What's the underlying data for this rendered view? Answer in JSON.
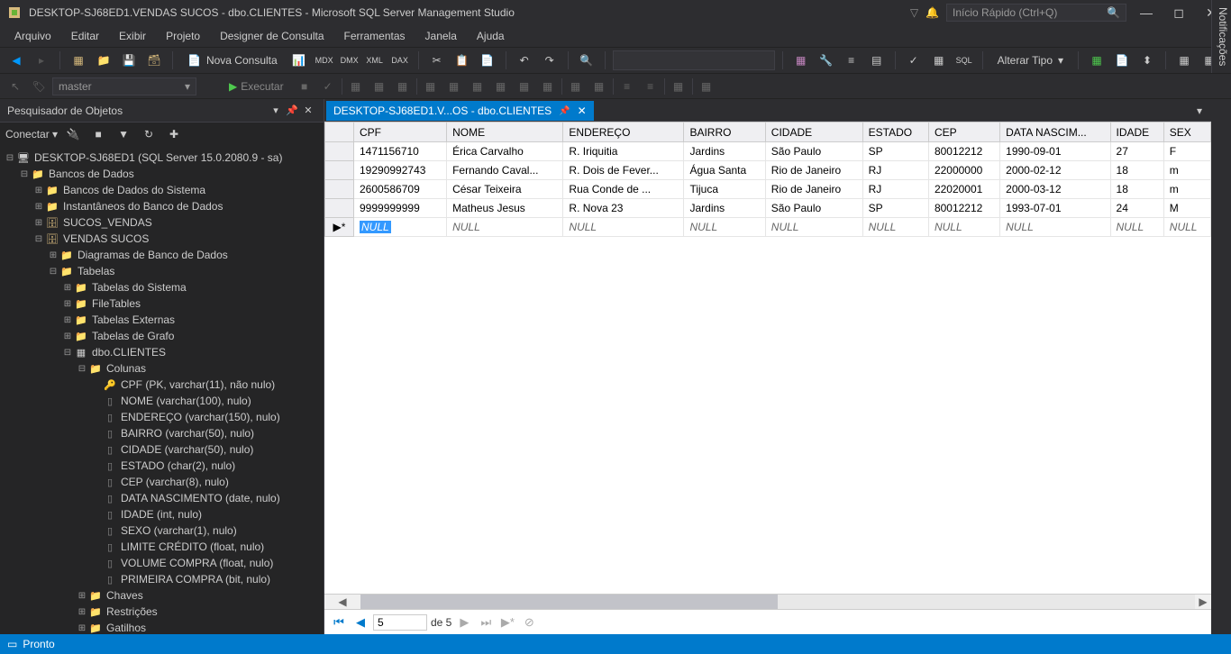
{
  "window": {
    "title": "DESKTOP-SJ68ED1.VENDAS SUCOS - dbo.CLIENTES - Microsoft SQL Server Management Studio",
    "quick_launch_placeholder": "Início Rápido (Ctrl+Q)"
  },
  "menu": [
    "Arquivo",
    "Editar",
    "Exibir",
    "Projeto",
    "Designer de Consulta",
    "Ferramentas",
    "Janela",
    "Ajuda"
  ],
  "toolbar": {
    "nova_consulta": "Nova Consulta",
    "alterar_tipo": "Alterar Tipo"
  },
  "toolbar2": {
    "db": "master",
    "executar": "Executar"
  },
  "object_explorer": {
    "title": "Pesquisador de Objetos",
    "connect": "Conectar",
    "server": "DESKTOP-SJ68ED1 (SQL Server 15.0.2080.9 - sa)",
    "nodes": {
      "bancos": "Bancos de Dados",
      "sistema": "Bancos de Dados do Sistema",
      "instantaneos": "Instantâneos do Banco de Dados",
      "sucos_vendas": "SUCOS_VENDAS",
      "vendas_sucos": "VENDAS SUCOS",
      "diagramas": "Diagramas de Banco de Dados",
      "tabelas": "Tabelas",
      "tabelas_sistema": "Tabelas do Sistema",
      "filetables": "FileTables",
      "tabelas_externas": "Tabelas Externas",
      "tabelas_grafo": "Tabelas de Grafo",
      "dbo_clientes": "dbo.CLIENTES",
      "colunas": "Colunas",
      "cols": {
        "cpf": "CPF (PK, varchar(11), não nulo)",
        "nome": "NOME (varchar(100), nulo)",
        "endereco": "ENDEREÇO (varchar(150), nulo)",
        "bairro": "BAIRRO (varchar(50), nulo)",
        "cidade": "CIDADE (varchar(50), nulo)",
        "estado": "ESTADO (char(2), nulo)",
        "cep": "CEP (varchar(8), nulo)",
        "data_nasc": "DATA NASCIMENTO (date, nulo)",
        "idade": "IDADE (int, nulo)",
        "sexo": "SEXO (varchar(1), nulo)",
        "limite": "LIMITE CRÉDITO (float, nulo)",
        "volume": "VOLUME COMPRA (float, nulo)",
        "primeira": "PRIMEIRA COMPRA (bit, nulo)"
      },
      "chaves": "Chaves",
      "restricoes": "Restrições",
      "gatilhos": "Gatilhos"
    }
  },
  "tab": {
    "label": "DESKTOP-SJ68ED1.V...OS - dbo.CLIENTES"
  },
  "grid": {
    "columns": [
      "CPF",
      "NOME",
      "ENDEREÇO",
      "BAIRRO",
      "CIDADE",
      "ESTADO",
      "CEP",
      "DATA NASCIM...",
      "IDADE",
      "SEX"
    ],
    "rows": [
      {
        "cpf": "1471156710",
        "nome": "Érica Carvalho",
        "end": "R. Iriquitia",
        "bairro": "Jardins",
        "cidade": "São Paulo",
        "estado": "SP",
        "cep": "80012212",
        "data": "1990-09-01",
        "idade": "27",
        "sexo": "F"
      },
      {
        "cpf": "19290992743",
        "nome": "Fernando Caval...",
        "end": "R. Dois de Fever...",
        "bairro": "Água Santa",
        "cidade": "Rio de Janeiro",
        "estado": "RJ",
        "cep": "22000000",
        "data": "2000-02-12",
        "idade": "18",
        "sexo": "m"
      },
      {
        "cpf": "2600586709",
        "nome": "César Teixeira",
        "end": "Rua Conde de ...",
        "bairro": "Tijuca",
        "cidade": "Rio de Janeiro",
        "estado": "RJ",
        "cep": "22020001",
        "data": "2000-03-12",
        "idade": "18",
        "sexo": "m"
      },
      {
        "cpf": "9999999999",
        "nome": "Matheus Jesus",
        "end": "R. Nova 23",
        "bairro": "Jardins",
        "cidade": "São Paulo",
        "estado": "SP",
        "cep": "80012212",
        "data": "1993-07-01",
        "idade": "24",
        "sexo": "M"
      }
    ],
    "null": "NULL"
  },
  "nav": {
    "pos": "5",
    "of": "de 5"
  },
  "status": {
    "ready": "Pronto"
  },
  "side_tab": "Notificações"
}
